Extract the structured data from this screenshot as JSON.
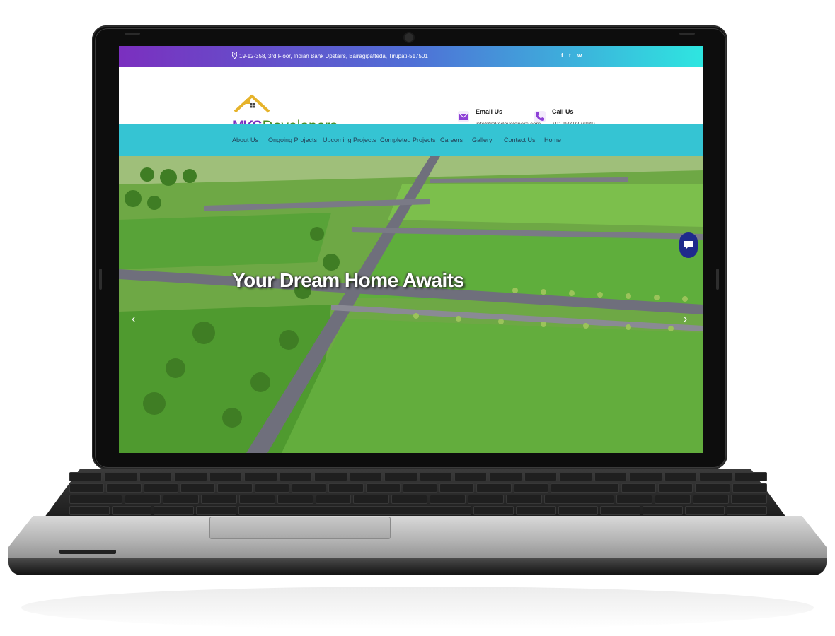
{
  "topbar": {
    "address": "19-12-358, 3rd Floor, Indian Bank Upstairs, Bairagipatteda, Tirupati-517501",
    "social_icons": [
      "facebook-icon",
      "twitter-icon",
      "whatsapp-icon"
    ],
    "social_glyphs": {
      "facebook": "f",
      "twitter": "t",
      "whatsapp": "w"
    }
  },
  "logo": {
    "brand_mks": "MKS",
    "brand_rest": "Developers"
  },
  "contact": {
    "email": {
      "title": "Email Us",
      "value": "info@mksdevelopers.com"
    },
    "phone": {
      "title": "Call Us",
      "value": "+91-9440224949"
    }
  },
  "nav": {
    "items": [
      "About Us",
      "Ongoing Projects",
      "Upcoming Projects",
      "Completed Projects",
      "Careers",
      "Gallery",
      "Contact Us",
      "Home"
    ]
  },
  "hero": {
    "title": "Your Dream Home Awaits",
    "prev_arrow": "‹",
    "next_arrow": "›"
  },
  "colors": {
    "topbar_gradient": [
      "#7b2fbf",
      "#2ee6e0"
    ],
    "nav_bg": "#35c4d3",
    "brand_purple": "#7b2fbf",
    "brand_green": "#3a9a2a",
    "chat_bubble": "#1f2a8c"
  }
}
